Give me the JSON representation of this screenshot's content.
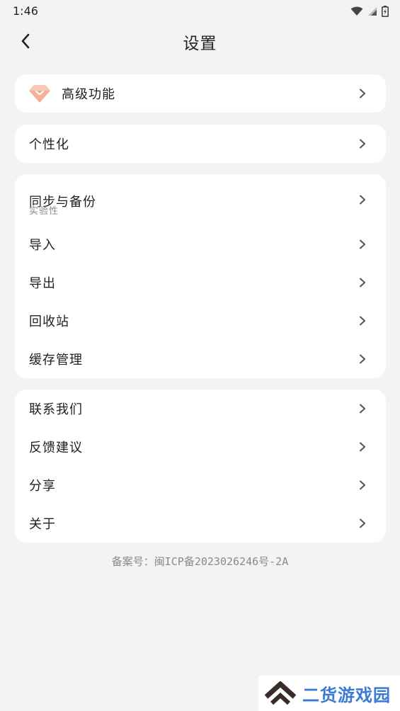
{
  "status_bar": {
    "time": "1:46"
  },
  "header": {
    "title": "设置"
  },
  "premium_card": {
    "label": "高级功能"
  },
  "personalize_card": {
    "label": "个性化"
  },
  "data_card": {
    "sync_label": "同步与备份",
    "sync_sublabel": "实验性",
    "import_label": "导入",
    "export_label": "导出",
    "recycle_label": "回收站",
    "cache_label": "缓存管理"
  },
  "about_card": {
    "contact_label": "联系我们",
    "feedback_label": "反馈建议",
    "share_label": "分享",
    "about_label": "关于"
  },
  "footer": {
    "icp": "备案号：闽ICP备2023026246号-2A"
  },
  "watermark": {
    "text": "二货游戏园"
  },
  "colors": {
    "background": "#f3f3f3",
    "card": "#ffffff",
    "premium_icon": "#f2b8a0"
  }
}
